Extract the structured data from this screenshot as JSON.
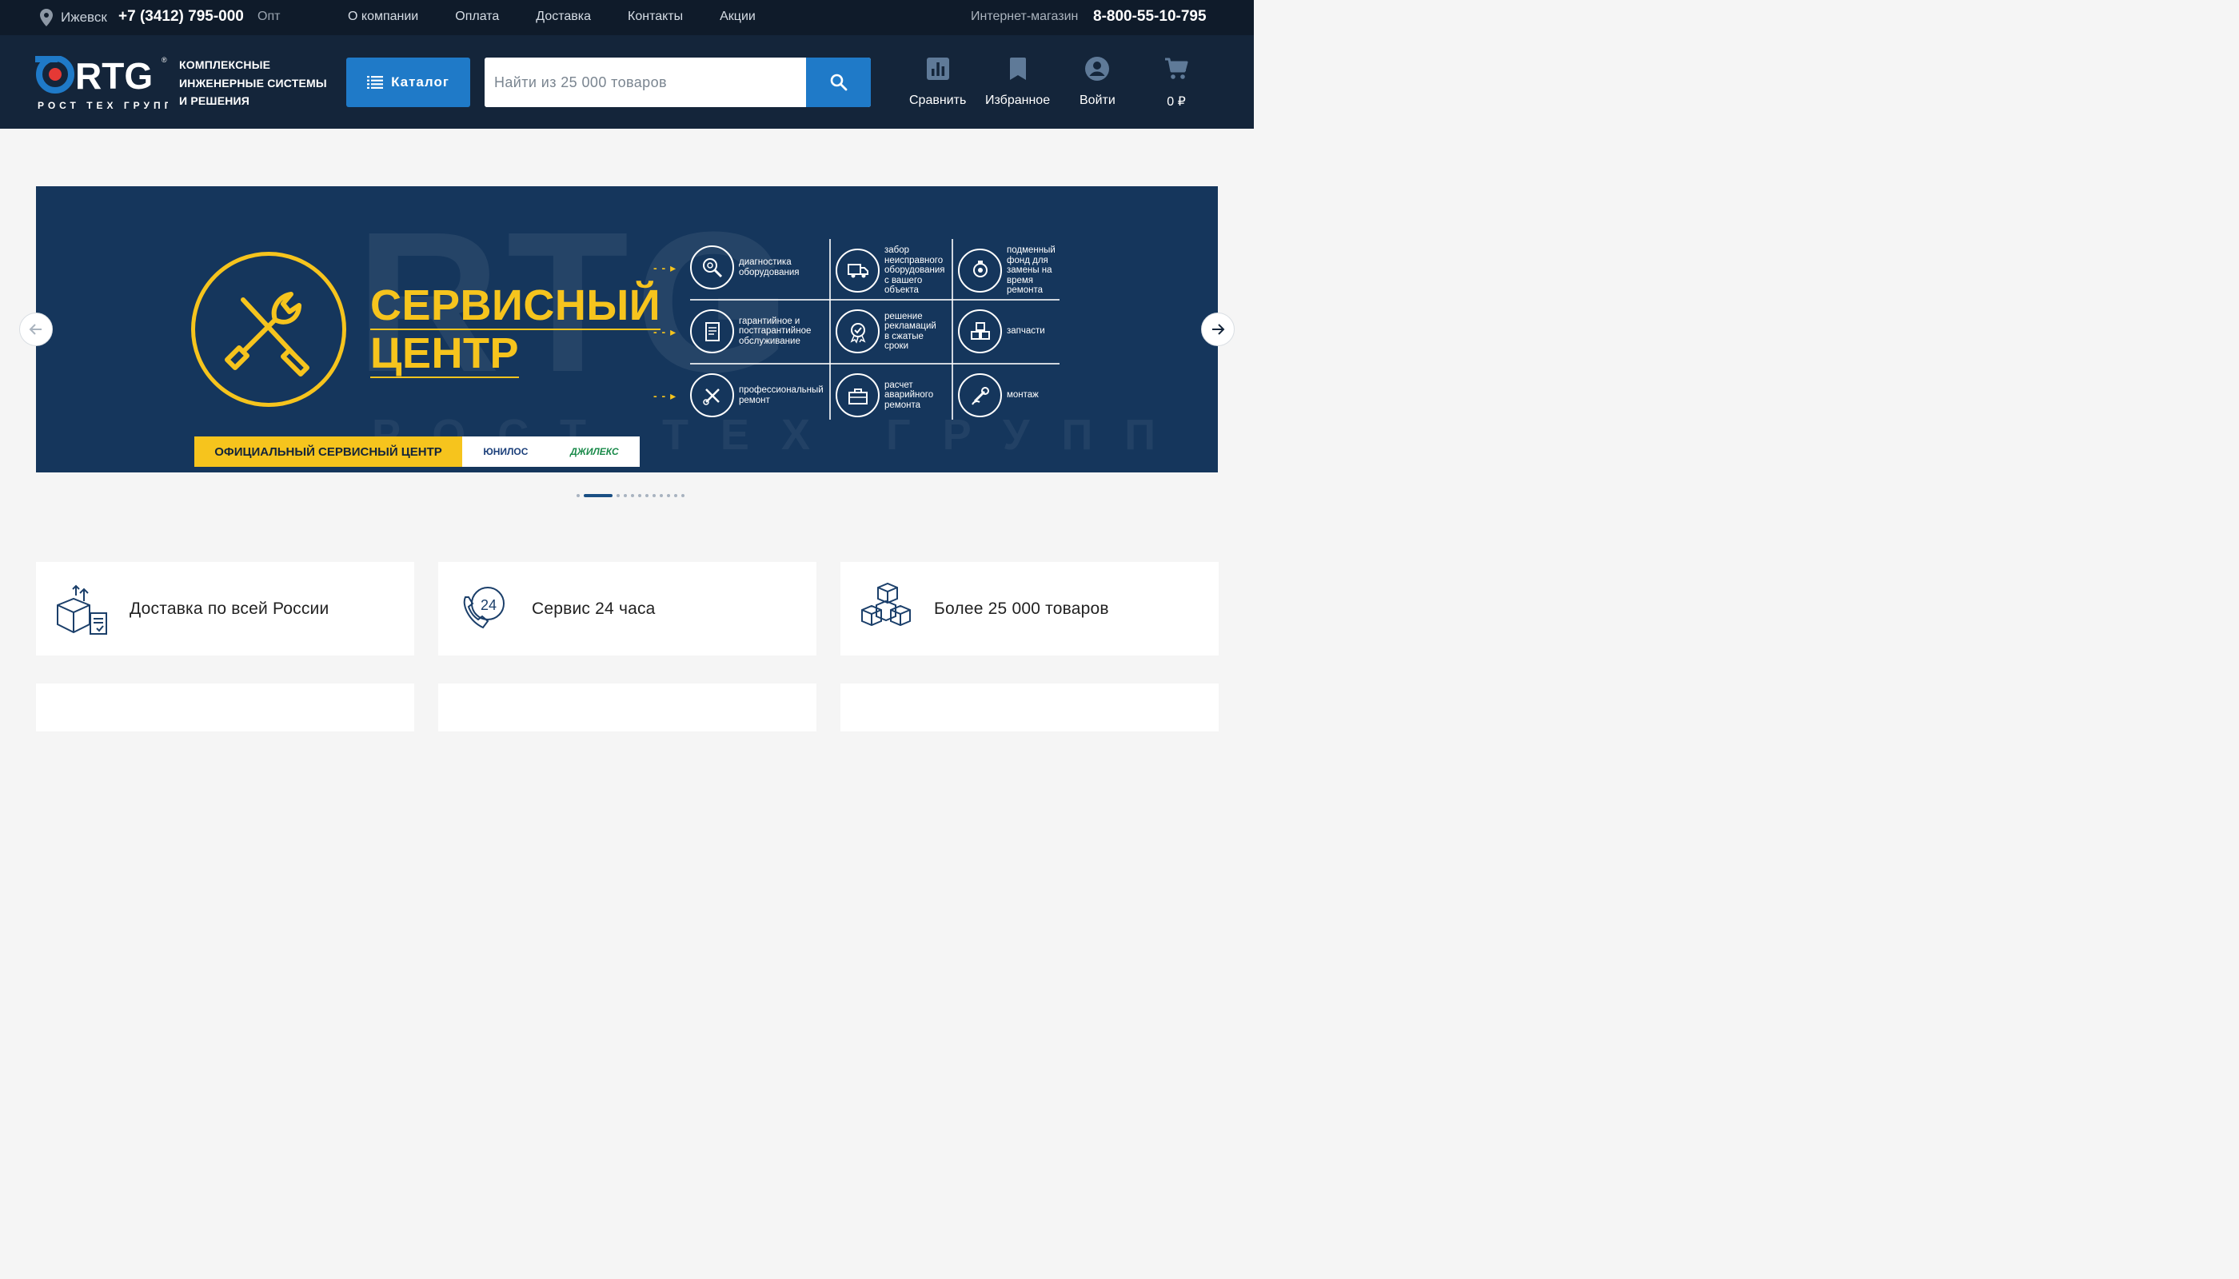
{
  "topbar": {
    "city": "Ижевск",
    "phone": "+7 (3412) 795-000",
    "opt": "Опт",
    "nav": [
      "О компании",
      "Оплата",
      "Доставка",
      "Контакты",
      "Акции"
    ],
    "shop_label": "Интернет-магазин",
    "hotline": "8-800-55-10-795"
  },
  "header": {
    "logo_text": "RTG",
    "logo_sub": "РОСТ ТЕХ ГРУПП",
    "tagline": [
      "КОМПЛЕКСНЫЕ",
      "ИНЖЕНЕРНЫЕ СИСТЕМЫ",
      "И РЕШЕНИЯ"
    ],
    "catalog_label": "Каталог",
    "search_placeholder": "Найти из 25 000 товаров",
    "compare_label": "Сравнить",
    "favorites_label": "Избранное",
    "login_label": "Войти",
    "cart_total": "0 ₽"
  },
  "banner": {
    "title_line1": "СЕРВИСНЫЙ",
    "title_line2": "ЦЕНТР",
    "watermark": "RTG",
    "watermark_sub": "РОСТ ТЕХ ГРУПП",
    "official": "ОФИЦИАЛЬНЫЙ СЕРВИСНЫЙ ЦЕНТР",
    "brand1": "ЮНИЛОС",
    "brand2": "ДЖИЛЕКС",
    "services": [
      {
        "text": "диагностика оборудования",
        "icon": "diagnostics-icon"
      },
      {
        "text": "забор неисправного оборудования с вашего объекта",
        "icon": "truck-icon"
      },
      {
        "text": "подменный фонд для замены на время ремонта",
        "icon": "pump-icon"
      },
      {
        "text": "гарантийное и постгарантийное обслуживание",
        "icon": "document-icon"
      },
      {
        "text": "решение рекламаций в сжатые сроки",
        "icon": "badge-icon"
      },
      {
        "text": "запчасти",
        "icon": "cubes-icon"
      },
      {
        "text": "профессиональный ремонт",
        "icon": "tools-icon"
      },
      {
        "text": "расчет аварийного ремонта",
        "icon": "toolbox-icon"
      },
      {
        "text": "монтаж",
        "icon": "wrench-hand-icon"
      }
    ],
    "slide_count": 12,
    "active_slide": 1
  },
  "features": [
    {
      "label": "Доставка по всей России",
      "icon": "delivery-box-icon"
    },
    {
      "label": "Сервис 24 часа",
      "icon": "phone-24-icon"
    },
    {
      "label": "Более 25 000 товаров",
      "icon": "boxes-icon"
    }
  ],
  "colors": {
    "topbar_bg": "#0f1b2a",
    "header_bg": "#14253a",
    "accent": "#1f7ac8",
    "banner_bg": "#15365c",
    "banner_yellow": "#f6c41d"
  }
}
